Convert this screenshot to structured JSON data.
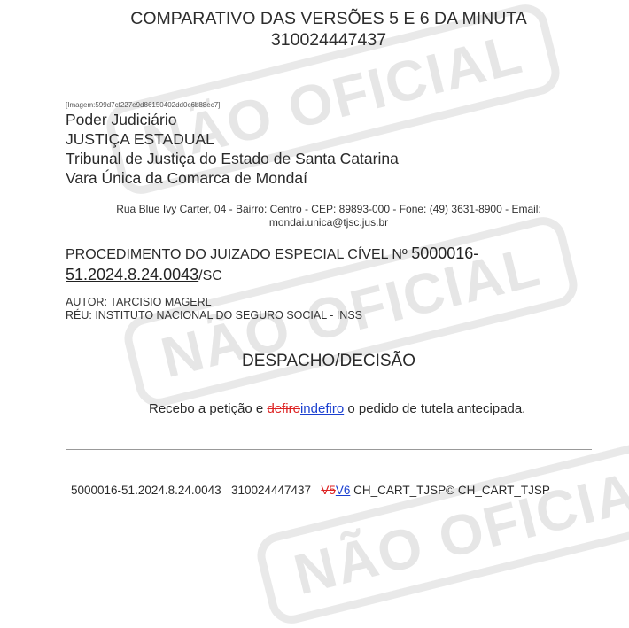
{
  "watermark": "NÃO OFICIAL",
  "title": {
    "line1": "COMPARATIVO DAS VERSÕES 5 E 6 DA MINUTA",
    "line2": "310024447437"
  },
  "image_tag": "[Imagem:599d7cf227e9d86150402dd0c6b88ec7]",
  "header": {
    "line1": "Poder Judiciário",
    "line2": "JUSTIÇA ESTADUAL",
    "line3": "Tribunal de Justiça do Estado de Santa Catarina",
    "line4": "Vara Única da Comarca de Mondaí"
  },
  "address": {
    "line1": "Rua Blue Ivy Carter, 04 - Bairro: Centro - CEP: 89893-000 - Fone: (49) 3631-8900 - Email:",
    "line2": "mondai.unica@tjsc.jus.br"
  },
  "procedure": {
    "prefix": "PROCEDIMENTO DO JUIZADO ESPECIAL CÍVEL Nº",
    "number": "5000016-51.2024.8.24.0043",
    "suffix": "/SC"
  },
  "parties": {
    "author": "AUTOR: TARCISIO MAGERL",
    "defendant": "RÉU: INSTITUTO NACIONAL DO SEGURO SOCIAL - INSS"
  },
  "heading": "DESPACHO/DECISÃO",
  "body": {
    "before": "Recebo a petição e ",
    "deleted": "defiro",
    "inserted": "indefiro",
    "after": " o pedido de tutela antecipada."
  },
  "footer": {
    "process": "5000016-51.2024.8.24.0043",
    "doc_id": "310024447437",
    "old_version": "V5",
    "new_version": "V6",
    "tail": "CH_CART_TJSP© CH_CART_TJSP"
  },
  "colors": {
    "deleted": "#d22222",
    "inserted": "#1a3fd0",
    "watermark": "#e6e6e6"
  }
}
